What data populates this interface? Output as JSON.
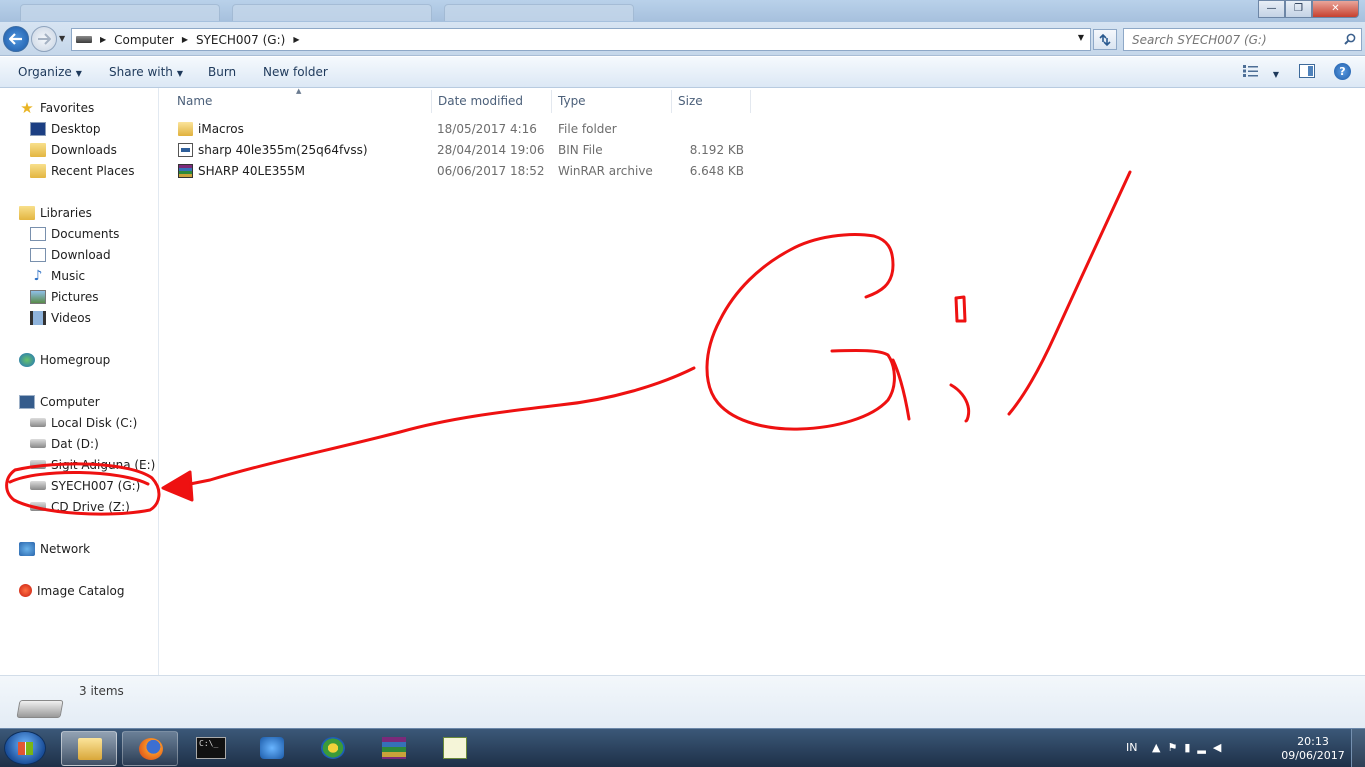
{
  "window": {
    "controls": {
      "minimize": "—",
      "maximize": "❐",
      "close": "✕"
    }
  },
  "address": {
    "crumbs": [
      "Computer",
      "SYECH007 (G:)"
    ],
    "search_placeholder": "Search SYECH007 (G:)"
  },
  "toolbar": {
    "organize": "Organize",
    "share_with": "Share with",
    "burn": "Burn",
    "new_folder": "New folder",
    "help": "?"
  },
  "navpane": {
    "favorites": {
      "label": "Favorites",
      "items": [
        "Desktop",
        "Downloads",
        "Recent Places"
      ]
    },
    "libraries": {
      "label": "Libraries",
      "items": [
        "Documents",
        "Download",
        "Music",
        "Pictures",
        "Videos"
      ]
    },
    "homegroup": "Homegroup",
    "computer": {
      "label": "Computer",
      "items": [
        "Local Disk (C:)",
        "Dat (D:)",
        "Sigit Adiguna (E:)",
        "SYECH007 (G:)",
        "CD Drive (Z:)"
      ]
    },
    "network": "Network",
    "image_catalog": "Image Catalog"
  },
  "content": {
    "columns": {
      "name": "Name",
      "date": "Date modified",
      "type": "Type",
      "size": "Size"
    },
    "rows": [
      {
        "name": "iMacros",
        "date": "18/05/2017 4:16",
        "type": "File folder",
        "size": "",
        "icon": "folder-icon"
      },
      {
        "name": "sharp 40le355m(25q64fvss)",
        "date": "28/04/2014 19:06",
        "type": "BIN File",
        "size": "8.192 KB",
        "icon": "bin-file-icon"
      },
      {
        "name": "SHARP 40LE355M",
        "date": "06/06/2017 18:52",
        "type": "WinRAR archive",
        "size": "6.648 KB",
        "icon": "winrar-icon"
      }
    ]
  },
  "details": {
    "items_count": "3 items"
  },
  "taskbar": {
    "cmd_glyph": "C:\\_",
    "tray_lang": "IN",
    "clock_time": "20:13",
    "clock_date": "09/06/2017"
  },
  "annotation": {
    "text": "G:/",
    "color": "#ee1111"
  }
}
